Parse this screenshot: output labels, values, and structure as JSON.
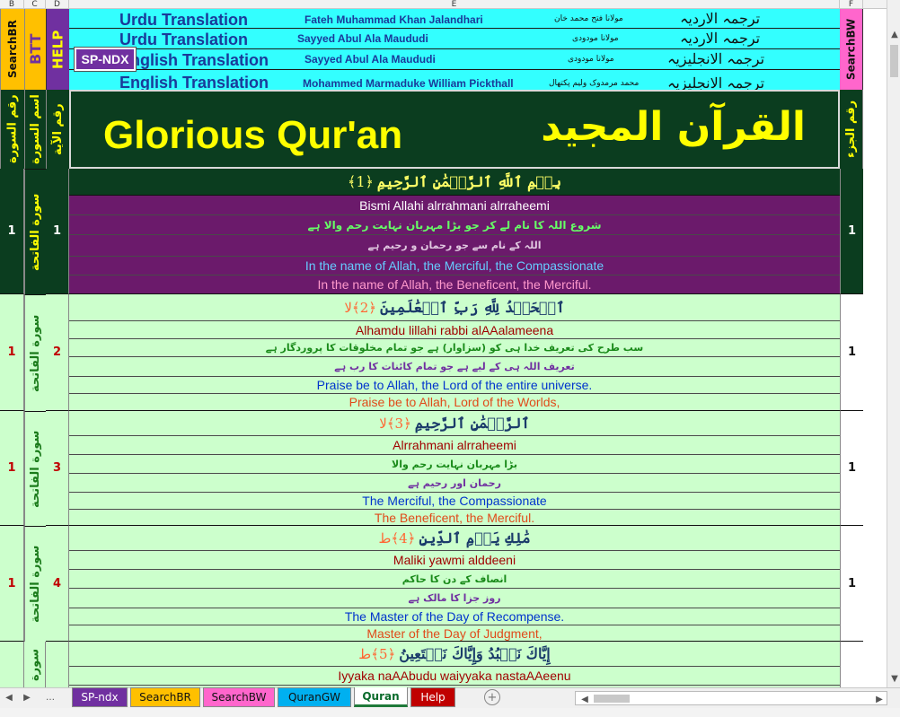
{
  "column_headers": {
    "b": "B",
    "c": "C",
    "d": "D",
    "e": "E",
    "f": "F"
  },
  "side_labels": {
    "search_br": "SearchBR",
    "btt": "BTT",
    "help": "HELP",
    "search_bw": "SearchBW",
    "surah_number": "رقم السورة",
    "surah_name": "اسم السورة",
    "ayah_number": "رقم الآية",
    "juz_number": "رقم الجزء"
  },
  "header_rows": [
    {
      "label": "Urdu Translation",
      "translator_en": "Fateh Muhammad Khan Jalandhari",
      "translator_ur": "مولانا فتح محمد خان",
      "lang_ar": "ترجمہ الاردیہ"
    },
    {
      "label": "Urdu Translation",
      "translator_en": "Sayyed Abul Ala Maududi",
      "translator_ur": "مولانا مودودی",
      "lang_ar": "ترجمہ الاردیہ"
    },
    {
      "label": "English Translation",
      "translator_en": "Sayyed Abul Ala Maududi",
      "translator_ur": "مولانا مودودی",
      "lang_ar": "ترجمہ الانجلیزیہ"
    },
    {
      "label": "English Translation",
      "translator_en": "Mohammed Marmaduke William Pickthall",
      "translator_ur": "محمد مرمدوک ولیم پکتھال",
      "lang_ar": "ترجمہ الانجلیزیہ"
    }
  ],
  "sp_ndx_button": "SP-NDX",
  "title": {
    "en": "Glorious Qur'an",
    "ar": "القرآن المجيد"
  },
  "verses": [
    {
      "surah": "1",
      "surah_name": "سورة الفاتحة",
      "ayah": "1",
      "juz": "1",
      "arabic": "بِسۡمِ ٱللَّهِ ٱلرَّحۡمَٰنِ ٱلرَّحِيمِ",
      "marker": "﴿1﴾",
      "translit": "Bismi Allahi alrrahmani alrraheemi",
      "urdu1": "شروع اللہ کا نام لے کر جو بڑا مہربان نہایت رحم والا ہے",
      "urdu2": "اللہ کے نام سے جو رحمان و رحیم ہے",
      "english1": "In the name of Allah, the Merciful, the Compassionate",
      "english2": "In the name of Allah, the Beneficent, the Merciful."
    },
    {
      "surah": "1",
      "surah_name": "سورة الفاتحة",
      "ayah": "2",
      "juz": "1",
      "arabic": "ٱلۡحَمۡدُ لِلَّهِ رَبِّ ٱلۡعَٰلَمِينَ",
      "marker": "﴿2﴾لا",
      "translit": "Alhamdu lillahi rabbi alAAalameena",
      "urdu1": "سب طرح کی تعریف خدا ہی کو (سزاوار) ہے جو تمام مخلوقات کا پروردگار ہے",
      "urdu2": "تعریف اللہ ہی کے لیے ہے جو تمام کائنات کا رب ہے",
      "english1": "Praise be to Allah, the Lord of the entire universe.",
      "english2": "Praise be to Allah, Lord of the Worlds,"
    },
    {
      "surah": "1",
      "surah_name": "سورة الفاتحة",
      "ayah": "3",
      "juz": "1",
      "arabic": "ٱلرَّحۡمَٰنِ ٱلرَّحِيمِ",
      "marker": "﴿3﴾لا",
      "translit": "Alrrahmani alrraheemi",
      "urdu1": "بڑا مہربان نہایت رحم والا",
      "urdu2": "رحمان اور رحیم ہے",
      "english1": "The Merciful, the Compassionate",
      "english2": "The Beneficent, the Merciful."
    },
    {
      "surah": "1",
      "surah_name": "سورة الفاتحة",
      "ayah": "4",
      "juz": "1",
      "arabic": "مَٰلِكِ يَوۡمِ ٱلدِّينِ",
      "marker": "﴿4﴾ط",
      "translit": "Maliki yawmi alddeeni",
      "urdu1": "انصاف کے دن کا حاکم",
      "urdu2": "روز جزا کا مالک ہے",
      "english1": "The Master of the Day of Recompense.",
      "english2": "Master of the Day of Judgment,"
    },
    {
      "surah": "",
      "surah_name": "سورة",
      "ayah": "",
      "juz": "",
      "arabic": "إِيَّاكَ نَعۡبُدُ وَإِيَّاكَ نَسۡتَعِينُ",
      "marker": "﴿5﴾ط",
      "translit": "Iyyaka naAAbudu waiyyaka nastaAAeenu"
    }
  ],
  "tabs": [
    {
      "label": "SP-ndx",
      "bg": "#7030a0",
      "fg": "#ffffff"
    },
    {
      "label": "SearchBR",
      "bg": "#ffc000",
      "fg": "#111111"
    },
    {
      "label": "SearchBW",
      "bg": "#ff66cc",
      "fg": "#111111"
    },
    {
      "label": "QuranGW",
      "bg": "#00b0f0",
      "fg": "#111111"
    },
    {
      "label": "Quran",
      "bg": "#ffffff",
      "fg": "#0a6b2b"
    },
    {
      "label": "Help",
      "bg": "#c00000",
      "fg": "#ffffff"
    }
  ],
  "colors": {
    "header_cyan": "#33ffff",
    "dark_green": "#0b3d1f",
    "purple": "#6b1a6b",
    "mint": "#ccffcc",
    "title_yellow": "#ffff00"
  }
}
